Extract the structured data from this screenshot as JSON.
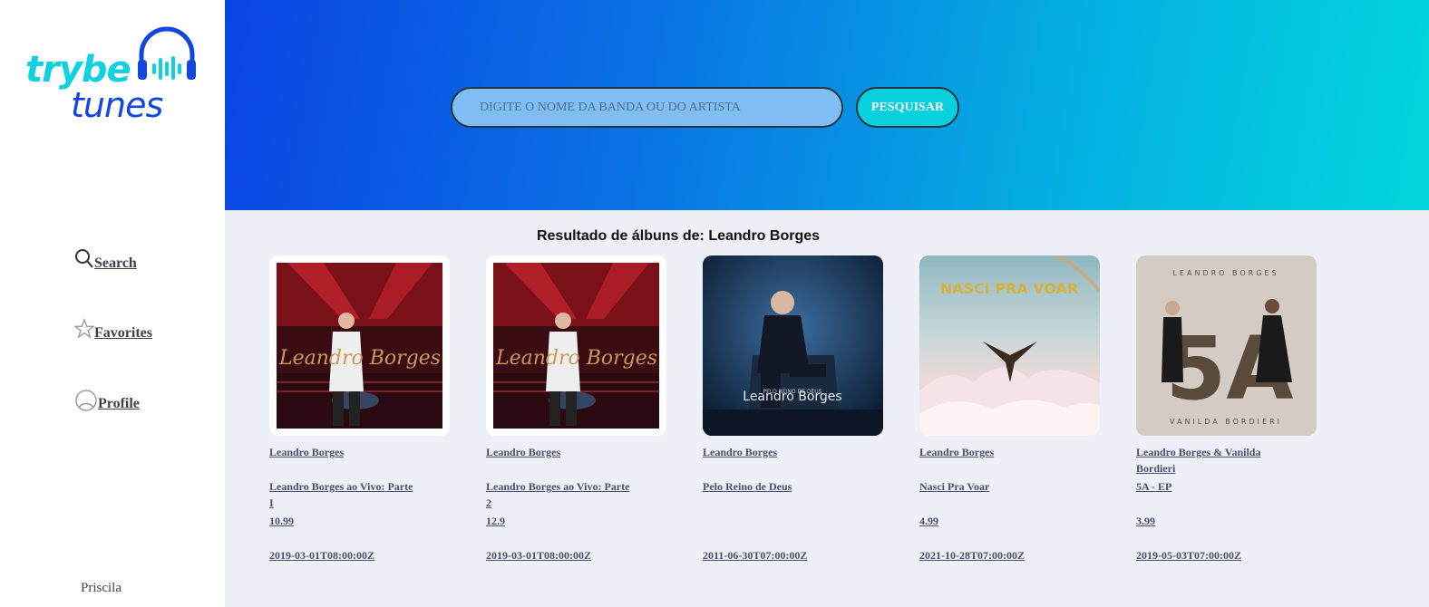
{
  "logo": {
    "line1": "trybe",
    "line2": "tunes"
  },
  "nav": [
    {
      "label": "Search",
      "icon": "search-icon"
    },
    {
      "label": "Favorites",
      "icon": "star-icon"
    },
    {
      "label": "Profile",
      "icon": "user-icon"
    }
  ],
  "user": {
    "name": "Priscila"
  },
  "search": {
    "placeholder": "DIGITE O NOME DA BANDA OU DO ARTISTA",
    "button_label": "PESQUISAR"
  },
  "results": {
    "title": "Resultado de álbuns de: Leandro Borges",
    "albums": [
      {
        "artist": "Leandro Borges",
        "name": "Leandro Borges ao Vivo: Parte I",
        "price": "10.99",
        "date": "2019-03-01T08:00:00Z"
      },
      {
        "artist": "Leandro Borges",
        "name": "Leandro Borges ao Vivo: Parte 2",
        "price": "12.9",
        "date": "2019-03-01T08:00:00Z"
      },
      {
        "artist": "Leandro Borges",
        "name": "Pelo Reino de Deus",
        "price": "",
        "date": "2011-06-30T07:00:00Z"
      },
      {
        "artist": "Leandro Borges",
        "name": "Nasci Pra Voar",
        "price": "4.99",
        "date": "2021-10-28T07:00:00Z"
      },
      {
        "artist": "Leandro Borges & Vanilda Bordieri",
        "name": "5A - EP",
        "price": "3.99",
        "date": "2019-05-03T07:00:00Z"
      }
    ]
  },
  "colors": {
    "brand_cyan": "#10d1e0",
    "brand_blue": "#1346e0",
    "header_start": "#0b44e4",
    "header_end": "#02d6dc"
  }
}
